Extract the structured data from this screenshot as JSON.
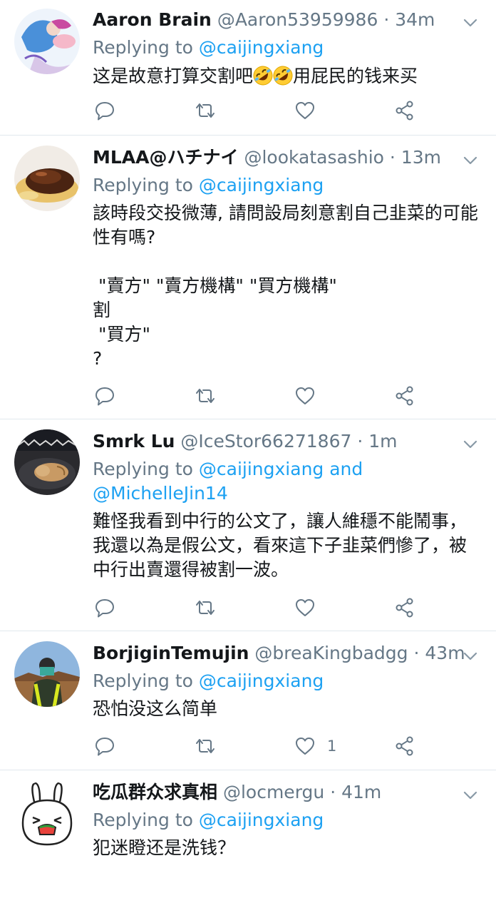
{
  "tweets": [
    {
      "name": "Aaron Brain",
      "handle": "@Aaron53959986",
      "dot": "·",
      "time": "34m",
      "replying_prefix": "Replying to ",
      "mentions": "@caijingxiang",
      "mentions_line2": "",
      "text_before_emoji": "这是故意打算交割吧",
      "text_after_emoji": "用屁民的钱来买",
      "emojis": [
        "rolling-laughing-emoji",
        "rolling-laughing-emoji"
      ],
      "like_count": ""
    },
    {
      "name": "MLAA@ハチナイ",
      "handle": "@lookatasashio",
      "dot": "·",
      "time": "13m",
      "replying_prefix": "Replying to ",
      "mentions": "@caijingxiang",
      "mentions_line2": "",
      "text": "該時段交投微薄, 請問設局刻意割自己韭菜的可能性有嗎?\n\n \"賣方\" \"賣方機構\" \"買方機構\"\n割\n \"買方\"\n?",
      "like_count": ""
    },
    {
      "name": "Smrk Lu",
      "handle": "@IceStor66271867",
      "dot": "·",
      "time": "1m",
      "replying_prefix": "Replying to ",
      "mentions": "@caijingxiang and",
      "mentions_line2": "@MichelleJin14",
      "text": "難怪我看到中行的公文了，讓人維穩不能鬧事，我還以為是假公文，看來這下子韭菜們慘了，被中行出賣還得被割一波。",
      "like_count": ""
    },
    {
      "name": "BorjiginTemujin",
      "handle": "@breaKingbadgg",
      "dot": "·",
      "time": "43m",
      "replying_prefix": "Replying to ",
      "mentions": "@caijingxiang",
      "mentions_line2": "",
      "text": "恐怕没这么简单",
      "like_count": "1"
    },
    {
      "name": "吃瓜群众求真相",
      "handle": "@locmergu",
      "dot": "·",
      "time": "41m",
      "replying_prefix": "Replying to ",
      "mentions": "@caijingxiang",
      "mentions_line2": "",
      "text": "犯迷瞪还是洗钱？",
      "like_count": ""
    }
  ],
  "icons": {
    "reply": "reply-icon",
    "retweet": "retweet-icon",
    "like": "heart-icon",
    "share": "share-icon",
    "menu": "chevron-down-icon"
  },
  "colors": {
    "link": "#1da1f2",
    "muted": "#657786",
    "text": "#14171a",
    "divider": "#e1e8ed"
  }
}
